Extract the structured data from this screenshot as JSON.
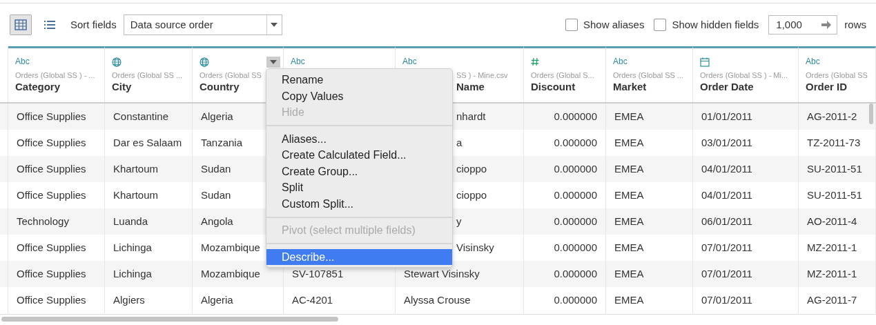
{
  "toolbar": {
    "views": [
      {
        "kind": "grid",
        "selected": true
      },
      {
        "kind": "list",
        "selected": false
      }
    ],
    "sort_label": "Sort fields",
    "sort_value": "Data source order",
    "options": [
      {
        "label": "Show aliases",
        "checked": false
      },
      {
        "label": "Show hidden fields",
        "checked": false
      }
    ],
    "rows_value": "1,000",
    "rows_label": "rows"
  },
  "columns": [
    {
      "kind": "string",
      "type_label": "Abc",
      "source": "Orders (Global SS ) - ...",
      "name": "Category"
    },
    {
      "kind": "geo",
      "source": "Orders (Global SS ...",
      "name": "City"
    },
    {
      "kind": "geo",
      "source": "Orders (Global SS",
      "name": "Country",
      "menu_open": true
    },
    {
      "kind": "string",
      "type_label": "Abc"
    },
    {
      "kind": "string",
      "type_label": "Abc",
      "source": "SS ) - Mine.csv",
      "name": "Name",
      "covered": true
    },
    {
      "kind": "number",
      "source": "Orders (Global S...",
      "name": "Discount"
    },
    {
      "kind": "string",
      "type_label": "Abc",
      "source": "Orders (Global SS ...",
      "name": "Market"
    },
    {
      "kind": "date",
      "source": "Orders (Global SS ) - Mi...",
      "name": "Order Date"
    },
    {
      "kind": "string",
      "type_label": "Abc",
      "source": "Orders (Global SS",
      "name": "Order ID"
    }
  ],
  "rows": [
    [
      "Office Supplies",
      "Constantine",
      "Algeria",
      null,
      {
        "text": "nhardt",
        "covered": true
      },
      "0.000000",
      "EMEA",
      "01/01/2011",
      "AG-2011-2"
    ],
    [
      "Office Supplies",
      "Dar es Salaam",
      "Tanzania",
      null,
      {
        "text": "a",
        "covered": true
      },
      "0.000000",
      "EMEA",
      "03/01/2011",
      "TZ-2011-73"
    ],
    [
      "Office Supplies",
      "Khartoum",
      "Sudan",
      null,
      {
        "text": "cioppo",
        "covered": true
      },
      "0.000000",
      "EMEA",
      "04/01/2011",
      "SU-2011-51"
    ],
    [
      "Office Supplies",
      "Khartoum",
      "Sudan",
      null,
      {
        "text": "cioppo",
        "covered": true
      },
      "0.000000",
      "EMEA",
      "04/01/2011",
      "SU-2011-51"
    ],
    [
      "Technology",
      "Luanda",
      "Angola",
      null,
      {
        "text": "y",
        "covered": true
      },
      "0.000000",
      "EMEA",
      "06/01/2011",
      "AO-2011-4"
    ],
    [
      "Office Supplies",
      "Lichinga",
      "Mozambique",
      null,
      {
        "text": "Visinsky",
        "covered": true
      },
      "0.000000",
      "EMEA",
      "07/01/2011",
      "MZ-2011-1"
    ],
    [
      "Office Supplies",
      "Lichinga",
      "Mozambique",
      "SV-107851",
      {
        "text": "Stewart Visinsky",
        "covered": false
      },
      "0.000000",
      "EMEA",
      "07/01/2011",
      "MZ-2011-1"
    ],
    [
      "Office Supplies",
      "Algiers",
      "Algeria",
      "AC-4201",
      {
        "text": "Alyssa Crouse",
        "covered": false
      },
      "0.000000",
      "EMEA",
      "07/01/2011",
      "AG-2011-7"
    ]
  ],
  "context_menu": [
    {
      "kind": "item",
      "label": "Rename",
      "disabled": false,
      "selected": false
    },
    {
      "kind": "item",
      "label": "Copy Values",
      "disabled": false,
      "selected": false
    },
    {
      "kind": "item",
      "label": "Hide",
      "disabled": true,
      "selected": false
    },
    {
      "kind": "separator"
    },
    {
      "kind": "item",
      "label": "Aliases...",
      "disabled": false,
      "selected": false
    },
    {
      "kind": "item",
      "label": "Create Calculated Field...",
      "disabled": false,
      "selected": false
    },
    {
      "kind": "item",
      "label": "Create Group...",
      "disabled": false,
      "selected": false
    },
    {
      "kind": "item",
      "label": "Split",
      "disabled": false,
      "selected": false
    },
    {
      "kind": "item",
      "label": "Custom Split...",
      "disabled": false,
      "selected": false
    },
    {
      "kind": "separator"
    },
    {
      "kind": "item",
      "label": "Pivot (select multiple fields)",
      "disabled": true,
      "selected": false
    },
    {
      "kind": "separator"
    },
    {
      "kind": "item",
      "label": "Describe...",
      "disabled": false,
      "selected": true
    }
  ]
}
